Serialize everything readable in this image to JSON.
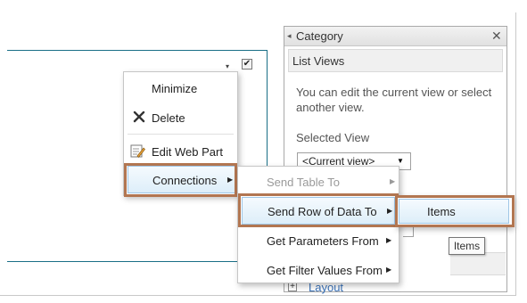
{
  "webpart": {
    "menu_chevron": "▾",
    "checkbox_mark": "✔"
  },
  "panel": {
    "title": "Category",
    "collapse_icon": "◂",
    "close_icon": "✕",
    "list_views": {
      "title": "List Views",
      "description": "You can edit the current view or select another view.",
      "selected_view_label": "Selected View",
      "selected_view_value": "<Current view>"
    },
    "layout_expand_icon": "+",
    "layout_label": "Layout"
  },
  "context_menu": {
    "items": [
      {
        "label": "Minimize",
        "icon": ""
      },
      {
        "label": "Delete",
        "icon": "delete-x-icon"
      },
      {
        "label": "Edit Web Part",
        "icon": "edit-webpart-icon"
      },
      {
        "label": "Connections",
        "icon": "",
        "has_submenu": true,
        "highlighted": true
      }
    ]
  },
  "connections_submenu": {
    "items": [
      {
        "label": "Send Table To",
        "disabled": true,
        "has_submenu": true
      },
      {
        "label": "Send Row of Data To",
        "has_submenu": true,
        "highlighted": true
      },
      {
        "label": "Get Parameters From",
        "has_submenu": true
      },
      {
        "label": "Get Filter Values From",
        "has_submenu": true
      }
    ]
  },
  "send_row_submenu": {
    "items": [
      {
        "label": "Items",
        "highlighted": true
      }
    ]
  },
  "tooltip": {
    "text": "Items"
  },
  "colors": {
    "highlight_border": "#9fc6e6",
    "callout_border": "#b27651",
    "webpart_border": "#1a6f86",
    "link": "#3b73b9"
  }
}
